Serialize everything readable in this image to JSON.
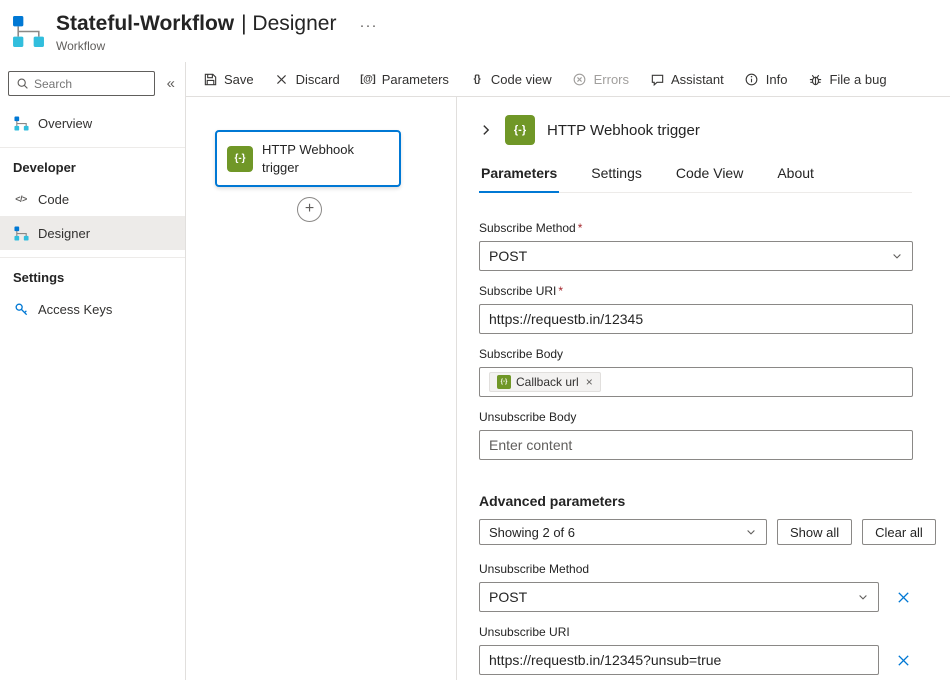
{
  "colors": {
    "accent": "#0078d4",
    "node_green": "#709727"
  },
  "app_header": {
    "title": "Stateful-Workflow",
    "title_suffix": "| Designer",
    "more": "···",
    "subtitle": "Workflow"
  },
  "icons": {
    "code": "</>",
    "parameters": "[@]",
    "code_view": "{}"
  },
  "sidebar": {
    "search": {
      "placeholder": "Search"
    },
    "collapse": "«",
    "overview": "Overview",
    "developer_section": "Developer",
    "code": "Code",
    "designer": "Designer",
    "settings_section": "Settings",
    "access_keys": "Access Keys"
  },
  "toolbar": {
    "save": "Save",
    "discard": "Discard",
    "parameters": "Parameters",
    "code_view": "Code view",
    "errors": "Errors",
    "assistant": "Assistant",
    "info": "Info",
    "file_a_bug": "File a bug"
  },
  "canvas": {
    "node": {
      "icon": "{-}",
      "title": "HTTP Webhook trigger"
    },
    "add_icon": "+"
  },
  "panel": {
    "icon": "{-}",
    "title": "HTTP Webhook trigger",
    "tabs": {
      "parameters": "Parameters",
      "settings": "Settings",
      "code_view": "Code View",
      "about": "About"
    },
    "subscribe_method": {
      "label": "Subscribe Method",
      "required": "*",
      "value": "POST"
    },
    "subscribe_uri": {
      "label": "Subscribe URI",
      "required": "*",
      "value": "https://requestb.in/12345"
    },
    "subscribe_body": {
      "label": "Subscribe Body",
      "token_icon": "{-}",
      "token": "Callback url",
      "token_remove": "×"
    },
    "unsubscribe_body": {
      "label": "Unsubscribe Body",
      "placeholder": "Enter content"
    },
    "advanced": {
      "heading": "Advanced parameters",
      "dropdown_value": "Showing 2 of 6",
      "show_all": "Show all",
      "clear_all": "Clear all"
    },
    "unsubscribe_method": {
      "label": "Unsubscribe Method",
      "value": "POST"
    },
    "unsubscribe_uri": {
      "label": "Unsubscribe URI",
      "value": "https://requestb.in/12345?unsub=true"
    }
  }
}
